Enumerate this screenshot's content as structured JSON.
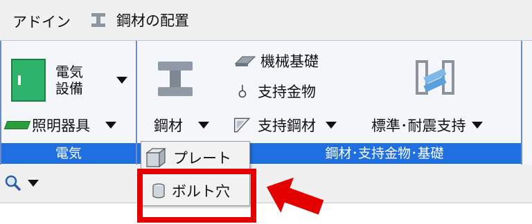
{
  "tabs": {
    "addin": "アドイン",
    "steel_layout": "鋼材の配置"
  },
  "ribbon": {
    "electric": {
      "denki_button": "電気\n設備",
      "lighting_button": "照明器具",
      "group_label": "電気"
    },
    "steel": {
      "steel_button": "鋼材",
      "machine_base": "機械基礎",
      "support_fitting": "支持金物",
      "support_steel": "支持鋼材",
      "standard_seismic": "標準･耐震支持",
      "group_label": "鋼材･支持金物･基礎"
    }
  },
  "dropdown": {
    "items": [
      "プレート",
      "ボルト穴"
    ]
  },
  "toolbar": {
    "search_icon": "search-icon"
  },
  "colors": {
    "accent": "#1f6fe0",
    "highlight": "#e50000",
    "ribbon_border": "#6b8cc8"
  }
}
